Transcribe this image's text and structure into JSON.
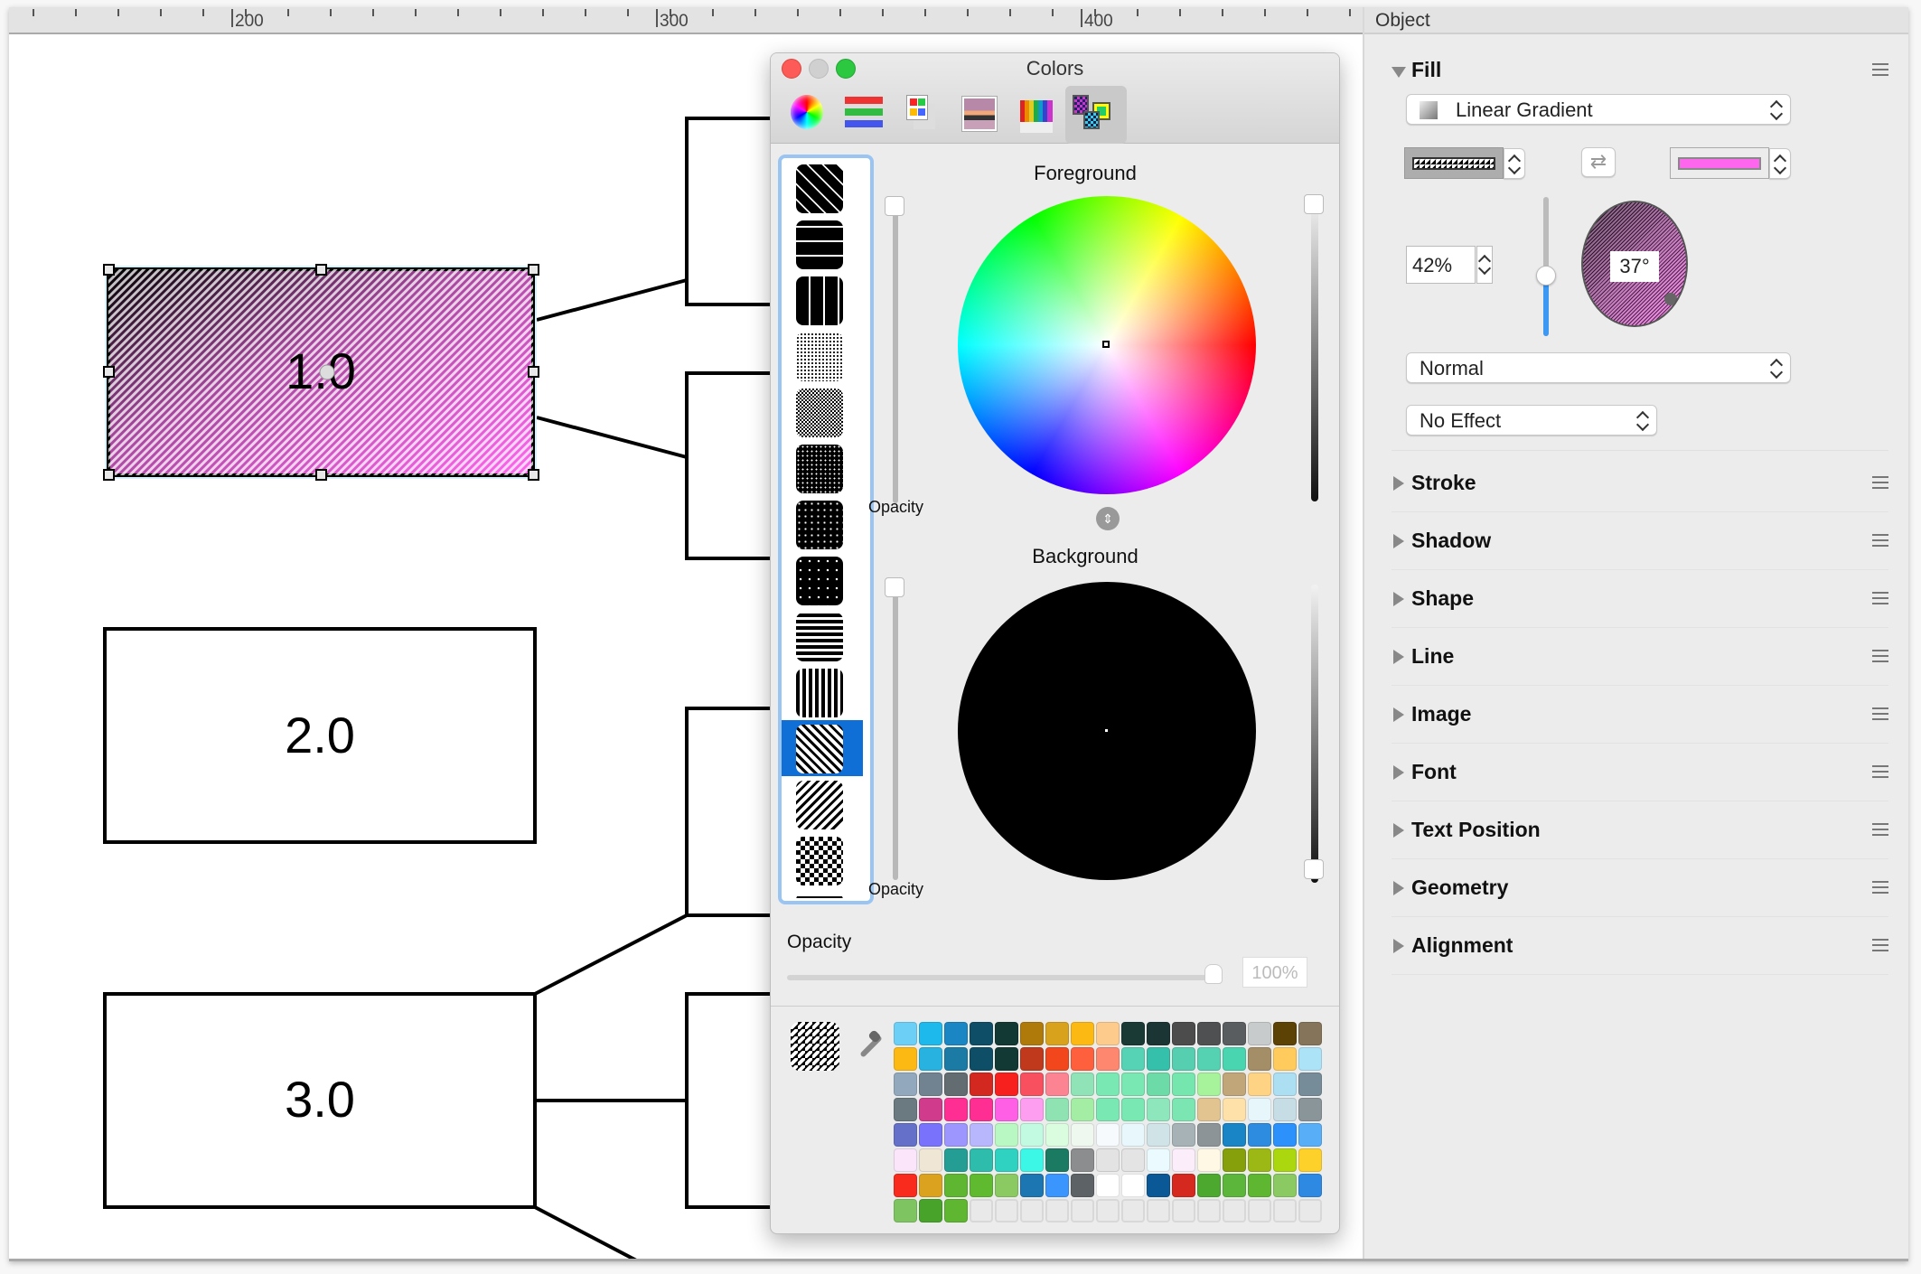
{
  "ruler": {
    "labels": [
      "200",
      "300",
      "400"
    ]
  },
  "canvas": {
    "nodes": [
      {
        "id": "1.0",
        "label": "1.0",
        "selected": true,
        "fill": "linear-gradient-pattern"
      },
      {
        "id": "2.0",
        "label": "2.0",
        "selected": false
      },
      {
        "id": "3.0",
        "label": "3.0",
        "selected": false
      }
    ]
  },
  "inspector": {
    "title": "Object",
    "fill": {
      "label": "Fill",
      "expanded": true,
      "fill_type": "Linear Gradient",
      "start_color": "pattern-diagonal-stripes",
      "end_color": "#ff66ee",
      "swap_icon": "swap-arrows-icon",
      "midpoint_value": "42%",
      "midpoint_fraction": 0.42,
      "angle_value": "37°",
      "blend_mode": "Normal",
      "effect": "No Effect"
    },
    "sections": [
      {
        "label": "Stroke"
      },
      {
        "label": "Shadow"
      },
      {
        "label": "Shape"
      },
      {
        "label": "Line"
      },
      {
        "label": "Image"
      },
      {
        "label": "Font"
      },
      {
        "label": "Text Position"
      },
      {
        "label": "Geometry"
      },
      {
        "label": "Alignment"
      }
    ]
  },
  "colors_panel": {
    "title": "Colors",
    "modes": [
      {
        "name": "color-wheel",
        "icon": "color-wheel-icon"
      },
      {
        "name": "color-sliders",
        "icon": "sliders-icon"
      },
      {
        "name": "color-palettes",
        "icon": "palettes-icon"
      },
      {
        "name": "image-palettes",
        "icon": "image-palette-icon"
      },
      {
        "name": "pencils",
        "icon": "pencils-icon"
      },
      {
        "name": "patterns",
        "icon": "patterns-icon",
        "active": true
      }
    ],
    "foreground_label": "Foreground",
    "background_label": "Background",
    "opacity_label": "Opacity",
    "fg_opacity_label": "Opacity",
    "bg_opacity_label": "Opacity",
    "opacity_value": "100%",
    "opacity_fraction": 1.0,
    "background_color": "#000000",
    "selected_pattern_index": 10,
    "patterns": [
      "wide-diagonal",
      "horizontal-bars",
      "vertical-bars",
      "fine-dots",
      "checker-fine",
      "dots-dense",
      "dots-medium",
      "dots-sparse",
      "horizontal-lines",
      "vertical-lines",
      "diagonal-left",
      "diagonal-right",
      "checkerboard",
      "dashes"
    ],
    "swatches": [
      [
        "#6cd0f6",
        "#1db8ec",
        "#1a87c4",
        "#0e4e66",
        "#133934",
        "#b07a0b",
        "#d9a21c",
        "#fdb913",
        "#fdcb8b",
        "#1a3a36",
        "#1b3534",
        "#4c4c4c",
        "#4e5052",
        "#5a5d60",
        "#c7cbcb",
        "#5d4205",
        "#857459"
      ],
      [
        "#fdb913",
        "#27b2e0",
        "#1b7ba5",
        "#0e4e66",
        "#133934",
        "#c0391d",
        "#f2461c",
        "#fe603e",
        "#fe8770",
        "#56d3b4",
        "#34c0aa",
        "#55cfb0",
        "#55d2b2",
        "#48d5b0",
        "#a48e67",
        "#fecb5c",
        "#ace3f7"
      ],
      [
        "#92a8bd",
        "#718291",
        "#636c70",
        "#d3281f",
        "#f8201f",
        "#f9505f",
        "#fc8392",
        "#8fe3b6",
        "#7ae8b2",
        "#7ae8b2",
        "#6cdba8",
        "#75e7ae",
        "#a6f39c",
        "#c0a678",
        "#fed484",
        "#acdff2",
        "#9dbdd2"
      ],
      [
        "#6a7a80",
        "#d13b8b",
        "#fe2e92",
        "#fe2e92",
        "#fe5fe5",
        "#fe9ef1",
        "#8fe3b3",
        "#a4eda4",
        "#7ae8b2",
        "#7ae8b2",
        "#8ee6bd",
        "#7be6b2",
        "#e1c48f",
        "#fee1a9",
        "#e7f6fb",
        "#c6dde5",
        "#9ba1a2"
      ],
      [
        "#6570c8",
        "#7872fd",
        "#9d96fe",
        "#b8b7fe",
        "#b9f8c3",
        "#c1fae0",
        "#dafde0",
        "#eef8ef",
        "#f6fafd",
        "#e8f7fc",
        "#d0e4e8",
        "#a7b2b6",
        "#8c9497",
        "#1985c6",
        "#2e8ce0",
        "#2d91fc",
        "#58aef7"
      ],
      [
        "#fbe5fb",
        "#f0e6d6",
        "#249e94",
        "#2ebcad",
        "#2fd1c1",
        "#3df7e6",
        "#1b7a62",
        "#8b8d8f",
        "#e3e3e3",
        "#e4e4e4",
        "#eafafe",
        "#fcedfa",
        "#fef8e4",
        "#85a00a",
        "#9cb815",
        "#aad70e",
        "#a4e60d"
      ],
      [
        "#f82b1d",
        "#dba21f",
        "#5fb630",
        "#5fba30",
        "#8bc963",
        "#1b76b2",
        "#3a95fd",
        "#5c6266",
        "#ffffff",
        "#ffffff",
        "#0b5896",
        "#d5291f",
        "#4ca82f",
        "#5cb63b",
        "#5fb630",
        "#8bc963",
        "#000000"
      ],
      [
        "#7ec562",
        "#47a32a",
        "#5fb630",
        "",
        "",
        "",
        "",
        "",
        "",
        "",
        "",
        "",
        "",
        "",
        "",
        "",
        ""
      ]
    ],
    "swatch_last_col": [
      "#857459",
      "#ace3f7",
      "#778c99",
      "#8a9599",
      "#58aef7",
      "#fed02a",
      "#2d89e2",
      ""
    ]
  }
}
